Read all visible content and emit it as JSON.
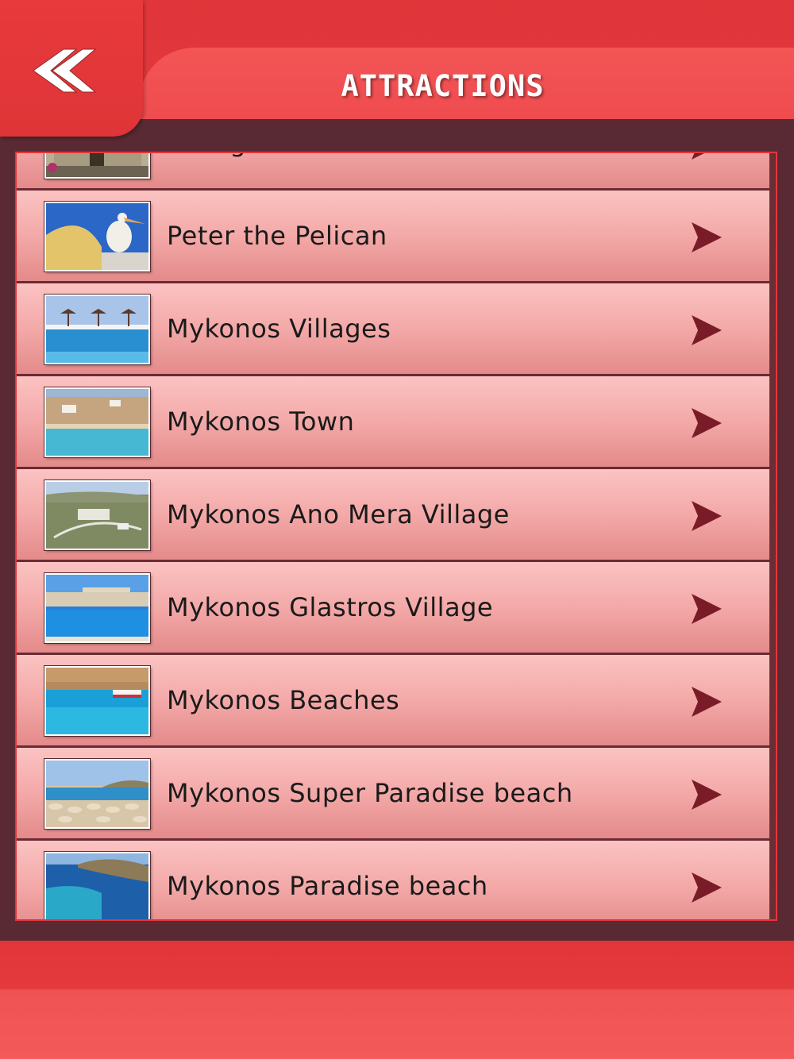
{
  "header": {
    "title": "ATTRACTIONS",
    "back_icon": "double-chevron-left-icon"
  },
  "list": {
    "row_icon": "play-arrow-right-icon",
    "items": [
      {
        "label": "Panagia Tourliani",
        "thumb": "monastery"
      },
      {
        "label": "Peter the Pelican",
        "thumb": "pelican"
      },
      {
        "label": "Mykonos Villages",
        "thumb": "pool-umbrellas"
      },
      {
        "label": "Mykonos Town",
        "thumb": "beach-town"
      },
      {
        "label": "Mykonos Ano Mera Village",
        "thumb": "village-hills"
      },
      {
        "label": "Mykonos Glastros Village",
        "thumb": "hotel-pool"
      },
      {
        "label": "Mykonos Beaches",
        "thumb": "boat-sea"
      },
      {
        "label": "Mykonos Super Paradise beach",
        "thumb": "umbrella-beach"
      },
      {
        "label": "Mykonos Paradise beach",
        "thumb": "bay"
      }
    ]
  },
  "colors": {
    "header_red": "#e0353a",
    "title_band": "#f35555",
    "frame_dark": "#5a2a34",
    "row_top": "#fbc3c2",
    "row_bottom": "#e48a8a",
    "chevron": "#7a1c28"
  }
}
